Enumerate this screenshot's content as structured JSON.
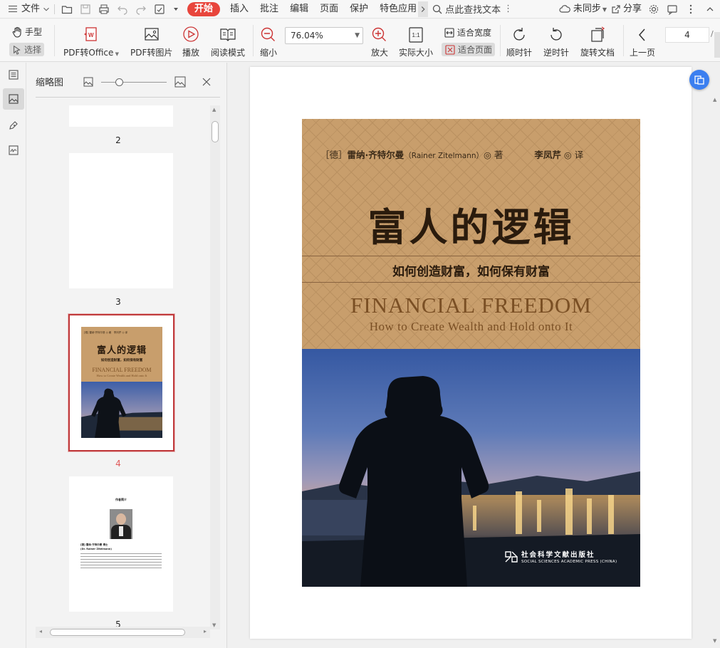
{
  "menubar": {
    "file": "文件",
    "tabs": [
      "开始",
      "插入",
      "批注",
      "编辑",
      "页面",
      "保护",
      "特色应用"
    ],
    "active_tab": "开始",
    "search": "点此查找文本",
    "sync": "未同步",
    "share": "分享",
    "accent": "#e8453c"
  },
  "ribbon": {
    "hand": "手型",
    "select": "选择",
    "pdf_to_office": "PDF转Office",
    "pdf_to_image": "PDF转图片",
    "play": "播放",
    "read_mode": "阅读模式",
    "zoom_out": "缩小",
    "zoom_value": "76.04%",
    "zoom_in": "放大",
    "actual_size": "实际大小",
    "fit_width": "适合宽度",
    "fit_page": "适合页面",
    "rotate_cw": "顺时针",
    "rotate_ccw": "逆时针",
    "rotate_doc": "旋转文档",
    "prev_page": "上一页",
    "page_number": "4"
  },
  "thumbnails": {
    "title": "缩略图",
    "pages": [
      "2",
      "3",
      "4",
      "5"
    ],
    "selected_page": "4",
    "selected_color": "#e05a5a",
    "thumb4": {
      "authors": "[德] 雷纳·齐特尔曼 ◎ 著　李凤芹 ◎ 译",
      "title": "富人的逻辑",
      "subtitle": "如何创造财富，如何保有财富",
      "en": "FINANCIAL FREEDOM",
      "en2": "How to Create Wealth and Hold onto It"
    },
    "thumb5": {
      "heading": "作者简介",
      "line1": "[德] 雷纳·齐特尔曼 博士",
      "line2": "(Dr. Rainer Zitelmann)"
    }
  },
  "cover": {
    "authors_prefix": "［德］",
    "author_cn": "雷纳·齐特尔曼",
    "author_en": "（Rainer Zitelmann）",
    "author_suffix": "◎ 著",
    "translator": "李凤芹",
    "translator_suffix": "◎ 译",
    "title": "富人的逻辑",
    "subtitle": "如何创造财富，如何保有财富",
    "english_title": "FINANCIAL FREEDOM",
    "english_subtitle": "How to Create Wealth and Hold onto It",
    "publisher_cn": "社会科学文献出版社",
    "publisher_en": "SOCIAL SCIENCES ACADEMIC PRESS (CHINA)"
  }
}
